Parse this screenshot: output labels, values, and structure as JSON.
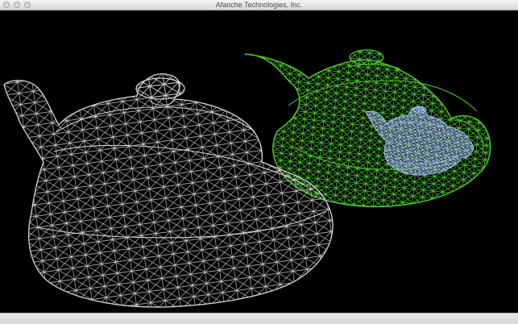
{
  "window": {
    "title": "Afanche Technologies, Inc."
  },
  "viewport": {
    "background_color": "#000000",
    "teapots": [
      {
        "name": "white-wireframe-teapot",
        "color": "#d7d7d7"
      },
      {
        "name": "green-wireframe-teapot",
        "color": "#4ac52d"
      },
      {
        "name": "blue-wireframe-teapot",
        "color": "#aab9ff"
      }
    ]
  },
  "icons": {
    "close": "close-icon",
    "minimize": "minimize-icon",
    "zoom": "zoom-icon"
  }
}
